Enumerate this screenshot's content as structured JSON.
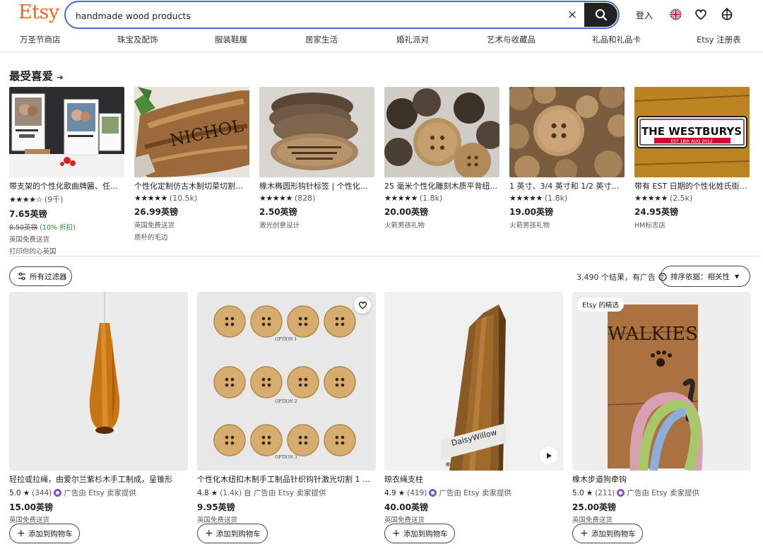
{
  "header": {
    "logo": "Etsy",
    "search_value": "handmade wood products",
    "clear": "×",
    "sign_in": "登入",
    "icons": [
      "search-icon",
      "uk-flag-icon",
      "heart-icon",
      "basket-icon"
    ]
  },
  "nav": [
    "万圣节商店",
    "珠宝及配饰",
    "服装鞋履",
    "居家生活",
    "婚礼派对",
    "艺术与收藏品",
    "礼品和礼品卡",
    "Etsy 注册表"
  ],
  "favorites": {
    "title": "最受喜爱",
    "arrow": "➔",
    "items": [
      {
        "name": "带支架的个性化歌曲牌匾、任何...",
        "stars": "★★★★☆",
        "count": "(9千)",
        "price": "7.65英镑",
        "old_price": "8.50英镑",
        "discount": "(10% 折扣)",
        "line1": "英国免费送货",
        "line2": "打印你的心英国"
      },
      {
        "name": "个性化定制仿古木制切菜切割奶...",
        "stars": "★★★★★",
        "count": "(10.5k)",
        "price": "26.99英镑",
        "line1": "英国免费送货",
        "line2": "质朴的毛边"
      },
      {
        "name": "橡木椭圆形钩针标签 | 个性化针...",
        "stars": "★★★★★",
        "count": "(828)",
        "price": "2.50英镑",
        "line1": "激光创意设计"
      },
      {
        "name": "25 毫米个性化雕刻木质平背纽...",
        "stars": "★★★★★",
        "count": "(1.8k)",
        "price": "20.00英镑",
        "line1": "火箭男孩礼物"
      },
      {
        "name": "1 英寸、3/4 英寸和 1/2 英寸针织...",
        "stars": "★★★★★",
        "count": "(1.8k)",
        "price": "19.00英镑",
        "line1": "火箭男孩礼物"
      },
      {
        "name": "带有 EST 日期的个性化姓氏街道...",
        "stars": "★★★★★",
        "count": "(2.5k)",
        "price": "24.95英镑",
        "line1": "HM标志店"
      }
    ]
  },
  "img_text": {
    "nichol": "NICHOL",
    "westburys": "THE WESTBURYS",
    "westburys_sub": "EST 18th AUG 2012",
    "walkies": "WALKIES",
    "daisy": "DaisyWillow",
    "option1": "OPTION 1",
    "option2": "OPTION 2",
    "option3": "OPTION 3"
  },
  "filters": {
    "all_filters": "所有过滤器",
    "results": "3,490 个结果，有广告",
    "sort": "排序依据：相关性"
  },
  "products": [
    {
      "name": "轻拉或拉绳，由爱尔兰紫杉木手工制成，呈锥形",
      "rating": "5.0",
      "count": "(344)",
      "ad": "广告由 Etsy 卖家提供",
      "price": "15.00英镑",
      "ship": "英国免费送货",
      "cart": "添加到购物车"
    },
    {
      "name": "个性化木纽扣木制手工制品针织钩针激光切割 1 英寸",
      "rating": "4.8",
      "count": "(1.4k)",
      "ad": "自 广告由 Etsy 卖家提供",
      "price": "9.95英镑",
      "ship": "英国免费送货",
      "cart": "添加到购物车"
    },
    {
      "name": "晾衣绳支柱",
      "rating": "4.9",
      "count": "(419)",
      "ad": "广告由 Etsy 卖家提供",
      "price": "40.00英镑",
      "ship": "英国免费送货",
      "cart": "添加到购物车"
    },
    {
      "name": "橡木步道狗牵钩",
      "rating": "5.0",
      "count": "(211)",
      "ad": "广告由 Etsy 卖家提供",
      "price": "25.00英镑",
      "ship": "英国免费送货",
      "cart": "添加到购物车",
      "badge": "Etsy 的精选"
    }
  ]
}
